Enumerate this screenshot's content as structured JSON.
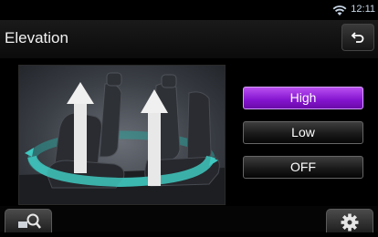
{
  "status": {
    "time": "12:11",
    "wifi_icon": "wifi-icon"
  },
  "header": {
    "title": "Elevation",
    "back_icon": "return-arrow-icon"
  },
  "illustration": {
    "name": "seat-elevation-illustration"
  },
  "options": [
    {
      "label": "High",
      "selected": true
    },
    {
      "label": "Low",
      "selected": false
    },
    {
      "label": "OFF",
      "selected": false
    }
  ],
  "footer": {
    "left_icon": "zoom-search-icon",
    "right_icon": "gear-icon"
  },
  "colors": {
    "accent": "#8a1ad6",
    "arrow": "#e8e8e8",
    "ring": "#3fc8c0"
  }
}
